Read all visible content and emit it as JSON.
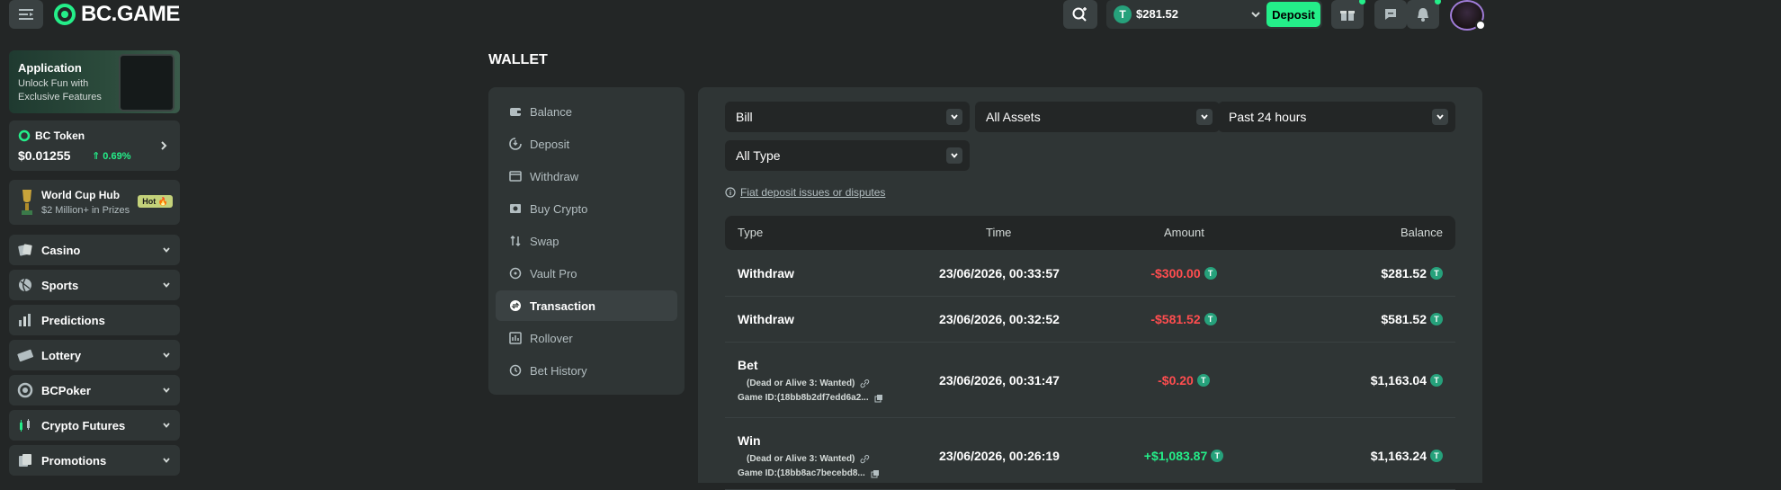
{
  "header": {
    "logo_text": "BC.GAME",
    "wallet_balance": "$281.52",
    "deposit_label": "Deposit",
    "coin_symbol": "T"
  },
  "sidebar": {
    "app_card": {
      "title": "Application",
      "subtitle": "Unlock Fun with Exclusive Features"
    },
    "token_card": {
      "title": "BC Token",
      "price": "$0.01255",
      "change": "0.69%"
    },
    "worldcup_card": {
      "title": "World Cup Hub",
      "subtitle": "$2 Million+ in Prizes",
      "badge": "Hot"
    },
    "items": [
      {
        "label": "Casino",
        "icon": "casino-icon",
        "expandable": true
      },
      {
        "label": "Sports",
        "icon": "sports-icon",
        "expandable": true
      },
      {
        "label": "Predictions",
        "icon": "predictions-icon",
        "expandable": false
      },
      {
        "label": "Lottery",
        "icon": "lottery-icon",
        "expandable": true
      },
      {
        "label": "BCPoker",
        "icon": "poker-icon",
        "expandable": true
      },
      {
        "label": "Crypto Futures",
        "icon": "futures-icon",
        "expandable": true
      },
      {
        "label": "Promotions",
        "icon": "promotions-icon",
        "expandable": true
      }
    ]
  },
  "page": {
    "title": "WALLET"
  },
  "wallet_menu": [
    {
      "label": "Balance",
      "icon": "balance-icon",
      "active": false
    },
    {
      "label": "Deposit",
      "icon": "deposit-icon",
      "active": false
    },
    {
      "label": "Withdraw",
      "icon": "withdraw-icon",
      "active": false
    },
    {
      "label": "Buy Crypto",
      "icon": "buy-crypto-icon",
      "active": false
    },
    {
      "label": "Swap",
      "icon": "swap-icon",
      "active": false
    },
    {
      "label": "Vault Pro",
      "icon": "vault-icon",
      "active": false
    },
    {
      "label": "Transaction",
      "icon": "transaction-icon",
      "active": true
    },
    {
      "label": "Rollover",
      "icon": "rollover-icon",
      "active": false
    },
    {
      "label": "Bet History",
      "icon": "history-icon",
      "active": false
    }
  ],
  "filters": {
    "record_type": "Bill",
    "assets": "All Assets",
    "period": "Past 24 hours",
    "type": "All Type"
  },
  "fiat_link": "Fiat deposit issues or disputes",
  "table": {
    "headers": {
      "type": "Type",
      "time": "Time",
      "amount": "Amount",
      "balance": "Balance"
    },
    "rows": [
      {
        "type": "Withdraw",
        "time": "23/06/2026, 00:33:57",
        "amount": "-$300.00",
        "balance": "$281.52"
      },
      {
        "type": "Withdraw",
        "time": "23/06/2026, 00:32:52",
        "amount": "-$581.52",
        "balance": "$581.52"
      },
      {
        "type": "Bet",
        "game": "(Dead or Alive 3: Wanted)",
        "game_id": "Game ID:(18bb8b2df7edd6a2...",
        "time": "23/06/2026, 00:31:47",
        "amount": "-$0.20",
        "balance": "$1,163.04"
      },
      {
        "type": "Win",
        "game": "(Dead or Alive 3: Wanted)",
        "game_id": "Game ID:(18bb8ac7becebd8...",
        "time": "23/06/2026, 00:26:19",
        "amount": "+$1,083.87",
        "balance": "$1,163.24"
      }
    ]
  },
  "colors": {
    "accent": "#24ee89",
    "negative": "#ff4d4f",
    "panel": "#2f3535",
    "background": "#232626"
  }
}
